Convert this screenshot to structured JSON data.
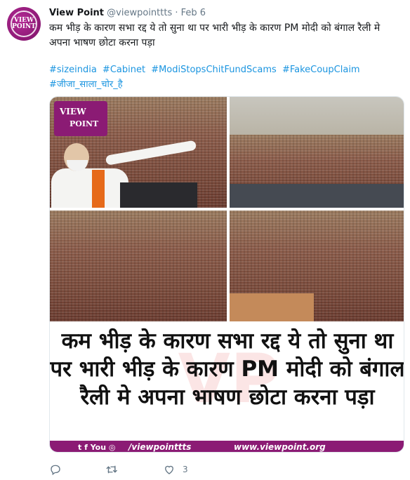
{
  "tweet": {
    "avatar_text": "VIEW POINT",
    "display_name": "View Point",
    "handle": "@viewpointtts",
    "separator": "·",
    "date": "Feb 6",
    "text": "कम भीड़ के कारण सभा रद्द ये तो सुना था पर भारी भीड़ के कारण PM मोदी को बंगाल रैली मे अपना भाषण छोटा करना पड़ा",
    "hashtags": [
      "#sizeindia",
      "#Cabinet",
      "#ModiStopsChitFundScams",
      "#FakeCoupClaim",
      "#जीजा_साला_चोर_है"
    ]
  },
  "media": {
    "logo_line1": "VIEW",
    "logo_line2": "POINT",
    "caption": "कम भीड़ के कारण सभा रद्द ये तो सुना था पर भारी भीड़ के कारण PM मोदी को बंगाल रैली मे अपना भाषण छोटा करना पड़ा",
    "watermark": "VP",
    "footer_icons": "t f You ◎",
    "footer_left": "/viewpointtts",
    "footer_right": "www.viewpoint.org"
  },
  "actions": {
    "reply_count": "",
    "retweet_count": "",
    "like_count": "3"
  },
  "colors": {
    "link": "#1b95e0",
    "muted": "#657786",
    "brand": "#8b1b74"
  },
  "icons": [
    "reply-icon",
    "retweet-icon",
    "like-icon"
  ]
}
